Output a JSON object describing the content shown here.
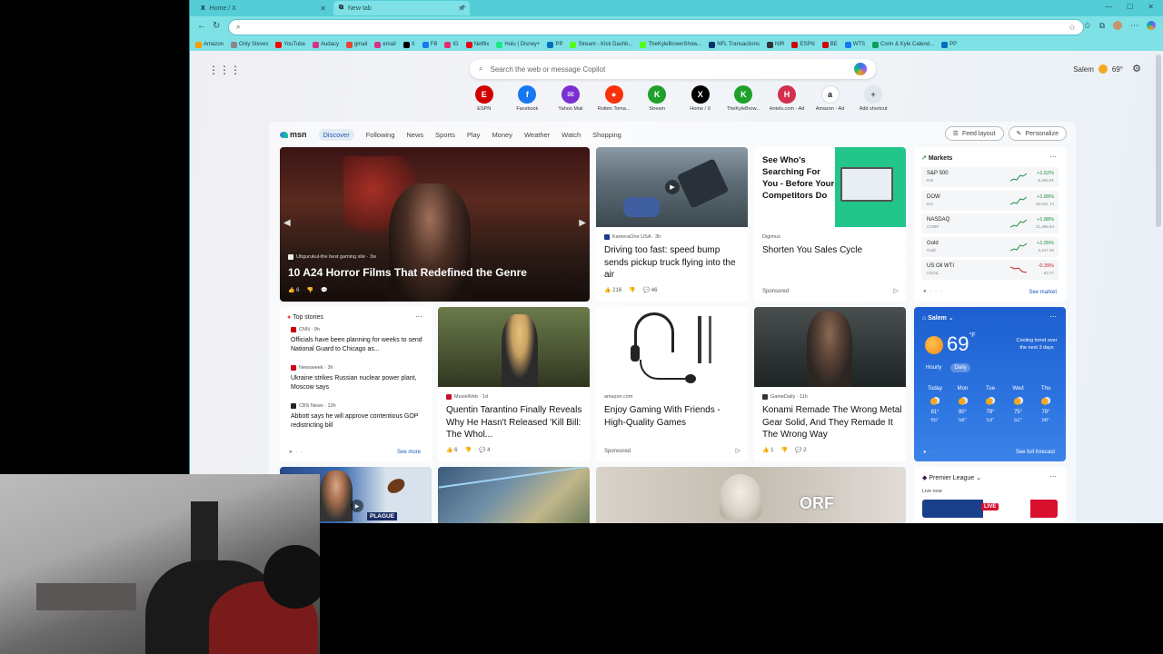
{
  "tabs": [
    {
      "title": "Home / X",
      "favicon": "X"
    },
    {
      "title": "New tab",
      "favicon": "⧉"
    }
  ],
  "address": {
    "value": ""
  },
  "bookmarks": [
    {
      "label": "Amazon",
      "color": "#ff9900"
    },
    {
      "label": "Only Steves",
      "color": "#888888"
    },
    {
      "label": "YouTube",
      "color": "#ff0000"
    },
    {
      "label": "Audacy",
      "color": "#d63384"
    },
    {
      "label": "gmail",
      "color": "#ea4335"
    },
    {
      "label": "email",
      "color": "#d63384"
    },
    {
      "label": "X",
      "color": "#000000"
    },
    {
      "label": "FB",
      "color": "#1877f2"
    },
    {
      "label": "IG",
      "color": "#e1306c"
    },
    {
      "label": "Netflix",
      "color": "#e50914"
    },
    {
      "label": "Hulu | Disney+",
      "color": "#1ce783"
    },
    {
      "label": "PP",
      "color": "#0070ba"
    },
    {
      "label": "Stream - Kick Dashb...",
      "color": "#53fc18"
    },
    {
      "label": "TheKyleBrownShow...",
      "color": "#53fc18"
    },
    {
      "label": "NFL Transactions",
      "color": "#013369"
    },
    {
      "label": "NIR",
      "color": "#333333"
    },
    {
      "label": "ESPN",
      "color": "#d00000"
    },
    {
      "label": "BE",
      "color": "#d00000"
    },
    {
      "label": "WTS",
      "color": "#1877f2"
    },
    {
      "label": "Conn & Kyle Calend...",
      "color": "#0f9d58"
    },
    {
      "label": "PP",
      "color": "#0070ba"
    }
  ],
  "search": {
    "placeholder": "Search the web or message Copilot"
  },
  "weather_top": {
    "city": "Salem",
    "temp": "69°"
  },
  "shortcuts": [
    {
      "label": "ESPN",
      "glyph": "E",
      "color": "#d00000"
    },
    {
      "label": "Facebook",
      "glyph": "f",
      "color": "#1877f2"
    },
    {
      "label": "Yahoo Mail",
      "glyph": "✉",
      "color": "#7b2fd0"
    },
    {
      "label": "Rotten Toma...",
      "glyph": "●",
      "color": "#fa320a"
    },
    {
      "label": "Stream",
      "glyph": "K",
      "color": "#1fa02a"
    },
    {
      "label": "Home / X",
      "glyph": "X",
      "color": "#000000"
    },
    {
      "label": "TheKyleBrow...",
      "glyph": "K",
      "color": "#1fa02a"
    },
    {
      "label": "Hotels.com · Ad",
      "glyph": "H",
      "color": "#d32f4f"
    },
    {
      "label": "Amazon · Ad",
      "glyph": "a",
      "color": "#ffffff"
    },
    {
      "label": "Add shortcut",
      "glyph": "+",
      "color": "#dfe6ec"
    }
  ],
  "feed": {
    "nav": [
      "Discover",
      "Following",
      "News",
      "Sports",
      "Play",
      "Money",
      "Weather",
      "Watch",
      "Shopping"
    ],
    "feed_layout": "Feed layout",
    "personalize": "Personalize"
  },
  "hero": {
    "source": "Ubgurukul-the best gaming site · 3w",
    "headline": "10 A24 Horror Films That Redefined the Genre",
    "likes": "6"
  },
  "card_kamera": {
    "source": "KameraOne USA · 3h",
    "headline": "Driving too fast: speed bump sends pickup truck flying into the air",
    "likes": "216",
    "comments": "46"
  },
  "ad_digimus": {
    "image_text": "See Who's Searching For You - Before Your Competitors Do",
    "source": "Digimus",
    "headline": "Shorten You Sales Cycle",
    "sponsored": "Sponsored"
  },
  "markets": {
    "title": "Markets",
    "rows": [
      {
        "name": "S&P 500",
        "sub": "INX",
        "change": "+1.52%",
        "value": "6,466.91",
        "color": "#1e8e3e"
      },
      {
        "name": "DOW",
        "sub": "DJI",
        "change": "+1.89%",
        "value": "45,631.74",
        "color": "#1e8e3e"
      },
      {
        "name": "NASDAQ",
        "sub": "COMP",
        "change": "+1.88%",
        "value": "21,496.54",
        "color": "#1e8e3e"
      },
      {
        "name": "Gold",
        "sub": "Gold",
        "change": "+1.05%",
        "value": "3,417.20",
        "color": "#1e8e3e"
      },
      {
        "name": "US Oil WTI",
        "sub": "USOIL",
        "change": "-0.39%",
        "value": "63.77",
        "color": "#c5221f"
      }
    ],
    "see_market": "See market"
  },
  "top_stories": {
    "title": "Top stories",
    "items": [
      {
        "source": "CNN · 9h",
        "headline": "Officials have been planning for weeks to send National Guard to Chicago as...",
        "color": "#cc0000"
      },
      {
        "source": "Newsweek · 3h",
        "headline": "Ukraine strikes Russian nuclear power plant, Moscow says",
        "color": "#d0021b"
      },
      {
        "source": "CBS News · 13h",
        "headline": "Abbott says he will approve contentious GOP redistricting bill",
        "color": "#222222"
      }
    ],
    "see_more": "See more"
  },
  "card_movieweb": {
    "source": "MovieWeb · 1d",
    "headline": "Quentin Tarantino Finally Reveals Why He Hasn't Released 'Kill Bill: The Whol...",
    "likes": "6",
    "comments": "4"
  },
  "ad_amazon": {
    "source": "amazon.com",
    "headline": "Enjoy Gaming With Friends - High-Quality Games",
    "sponsored": "Sponsored"
  },
  "card_gamedaily": {
    "source": "GameDaily · 11h",
    "headline": "Konami Remade The Wrong Metal Gear Solid, And They Remade It The Wrong Way",
    "likes": "1",
    "comments": "2"
  },
  "weather": {
    "city": "Salem",
    "temp": "69",
    "unit": "°F",
    "summary": "Cooling trend over the next 3 days",
    "tabs": [
      "Hourly",
      "Daily"
    ],
    "days": [
      {
        "name": "Today",
        "hi": "81°",
        "lo": "65°"
      },
      {
        "name": "Mon",
        "hi": "80°",
        "lo": "58°"
      },
      {
        "name": "Tue",
        "hi": "79°",
        "lo": "53°"
      },
      {
        "name": "Wed",
        "hi": "75°",
        "lo": "52°"
      },
      {
        "name": "Thu",
        "hi": "79°",
        "lo": "58°"
      }
    ],
    "see_forecast": "See full forecast"
  },
  "bottom": {
    "plague_label": "PLAGUE",
    "premier_league": "Premier League",
    "live_now": "Live now",
    "live_badge": "LIVE",
    "orf_text": "ORF"
  }
}
